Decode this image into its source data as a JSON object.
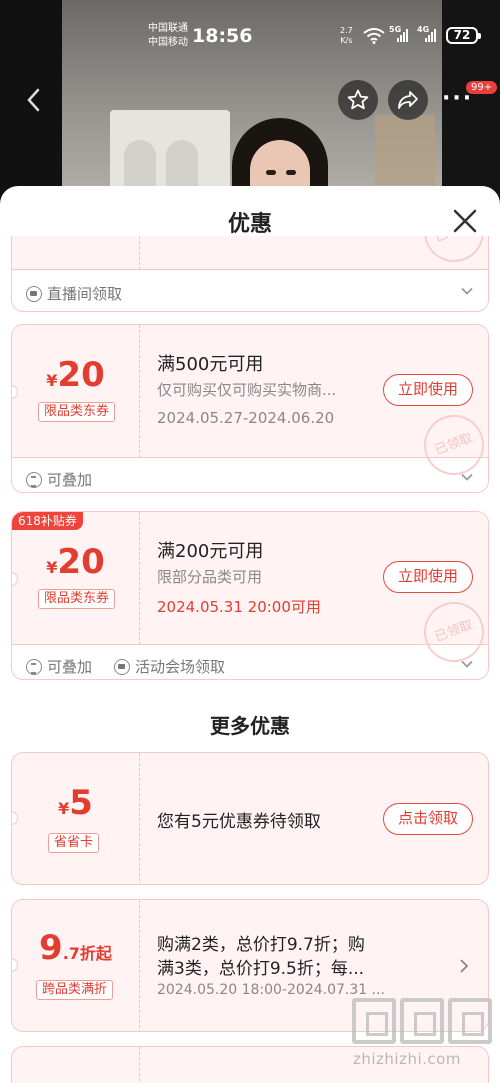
{
  "status_bar": {
    "carrier_1": "中国联通",
    "carrier_2": "中国移动",
    "time": "18:56",
    "net_speed_value": "2.7",
    "net_speed_unit": "K/s",
    "signal_1": "5G",
    "signal_2": "4G",
    "battery": "72"
  },
  "top_bar": {
    "notification_badge": "99+"
  },
  "sheet": {
    "title": "优惠",
    "partial_coupon": {
      "footer_source": "直播间领取",
      "stamp": "已领取"
    },
    "coupons": [
      {
        "yen": "¥",
        "amount": "20",
        "category": "限品类东券",
        "title": "满500元可用",
        "desc": "仅可购买仅可购买实物商品",
        "desc_display": "仅可购买仅可购买实物商...",
        "date": "2024.05.27-2024.06.20",
        "button": "立即使用",
        "stamp": "已领取",
        "footer_stack": "可叠加"
      },
      {
        "tag": "618补贴券",
        "yen": "¥",
        "amount": "20",
        "category": "限品类东券",
        "title": "满200元可用",
        "desc": "限部分品类可用",
        "date": "2024.05.31 20:00可用",
        "button": "立即使用",
        "stamp": "已领取",
        "footer_stack": "可叠加",
        "footer_source": "活动会场领取"
      }
    ],
    "more_section_title": "更多优惠",
    "more": [
      {
        "yen": "¥",
        "amount": "5",
        "category": "省省卡",
        "title": "您有5元优惠券待领取",
        "button": "点击领取"
      },
      {
        "amount_big": "9",
        "amount_small": ".7折起",
        "category": "跨品类满折",
        "title_line1": "购满2类，总价打9.7折；购",
        "title_line2": "满3类，总价打9.5折；每...",
        "date": "2024.05.20 18:00-2024.07.31 ..."
      }
    ]
  },
  "watermark": {
    "text": "zhizhizhi.com"
  },
  "colors": {
    "accent": "#e33c31",
    "coupon_bg": "#fff4f3",
    "coupon_border": "#f6c8c6"
  }
}
